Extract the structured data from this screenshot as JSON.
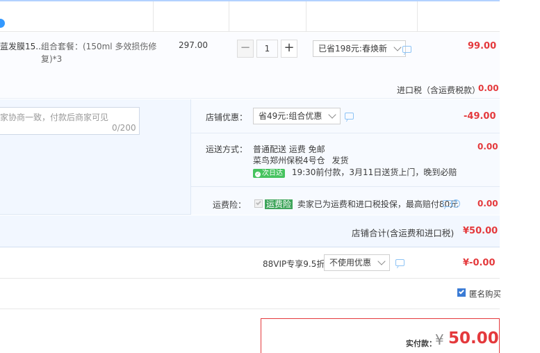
{
  "item": {
    "name": "蓝发膜15...",
    "sku": "组合套餐：(150ml 多效损伤修复)*3",
    "unit_price": "297.00",
    "quantity": "1",
    "minus": "−",
    "plus": "+",
    "promo_select": "已省198元:春焕新",
    "subtotal": "99.00"
  },
  "tax": {
    "label": "进口税（含运费税款）",
    "value": "0.00"
  },
  "memo": {
    "placeholder": "家协商一致，付款后商家可见",
    "count": "0/200"
  },
  "shop_discount": {
    "label": "店铺优惠：",
    "select": "省49元:组合优惠",
    "value": "-49.00"
  },
  "shipping": {
    "label": "运送方式：",
    "method": "普通配送 运费 免邮",
    "warehouse": "菜鸟郑州保税4号仓",
    "dispatch": "发货",
    "badge": "次日达",
    "eta": "19:30前付款，3月11日送货上门，晚到必赔",
    "value": "0.00"
  },
  "insurance": {
    "label": "运费险：",
    "tag": "运费险",
    "text": "卖家已为运费和进口税投保，最高赔付80元",
    "value": "0.00"
  },
  "shop_total": {
    "label": "店铺合计(含运费和进口税)",
    "value": "¥50.00"
  },
  "vip": {
    "label": "88VIP专享9.5折",
    "select": "不使用优惠",
    "value": "¥-0.00"
  },
  "anonymous": {
    "label": "匿名购买"
  },
  "pay": {
    "label": "实付款：",
    "currency": "¥",
    "amount": "50.00"
  },
  "colors": {
    "accent_red": "#e4393c",
    "accent_blue": "#3399ff",
    "panel_bg": "#f2f7ff"
  }
}
